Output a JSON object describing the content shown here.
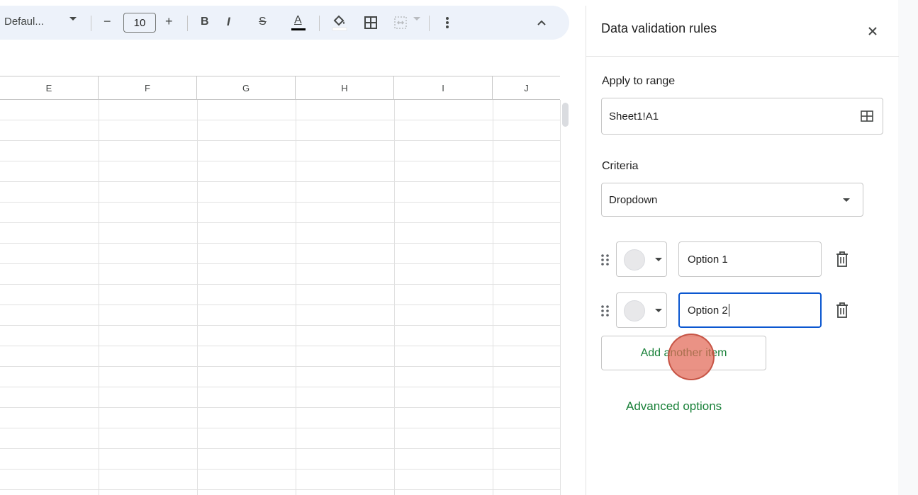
{
  "toolbar": {
    "font_name": "Defaul...",
    "minus": "−",
    "font_size": "10",
    "plus": "+",
    "bold": "B",
    "italic": "I",
    "strikethrough": "S",
    "text_color": "A",
    "text_color_swatch": "#000000",
    "icons": [
      "fill-color-icon",
      "borders-icon",
      "merge-cells-icon",
      "more-vert-icon",
      "collapse-toolbar-icon"
    ]
  },
  "grid": {
    "columns": [
      "E",
      "F",
      "G",
      "H",
      "I",
      "J"
    ]
  },
  "panel": {
    "title": "Data validation rules",
    "apply_label": "Apply to range",
    "range_value": "Sheet1!A1",
    "criteria_label": "Criteria",
    "criteria_value": "Dropdown",
    "options": [
      {
        "value": "Option 1",
        "swatch": "#e8e8ea"
      },
      {
        "value": "Option 2",
        "swatch": "#e8e8ea"
      }
    ],
    "add_item": "Add another item",
    "advanced": "Advanced options"
  },
  "colors": {
    "accent_green": "#188038",
    "focus_blue": "#0b57d0",
    "toolbar_bg": "#edf2fa",
    "click_marker": "#e26856"
  }
}
